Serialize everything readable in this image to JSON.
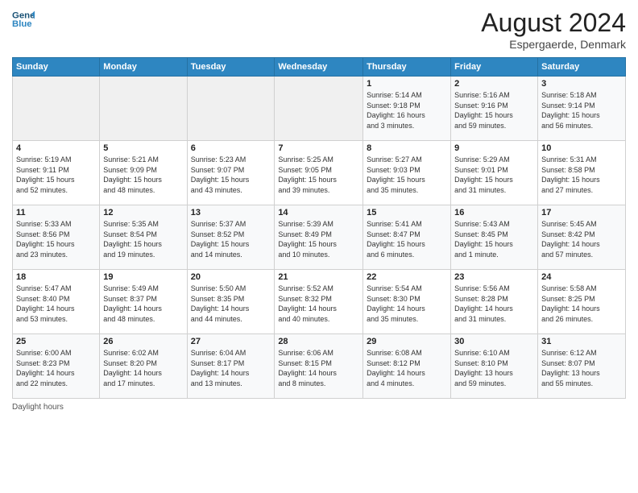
{
  "header": {
    "logo_line1": "General",
    "logo_line2": "Blue",
    "main_title": "August 2024",
    "subtitle": "Espergaerde, Denmark"
  },
  "weekdays": [
    "Sunday",
    "Monday",
    "Tuesday",
    "Wednesday",
    "Thursday",
    "Friday",
    "Saturday"
  ],
  "weeks": [
    [
      {
        "day": "",
        "info": ""
      },
      {
        "day": "",
        "info": ""
      },
      {
        "day": "",
        "info": ""
      },
      {
        "day": "",
        "info": ""
      },
      {
        "day": "1",
        "info": "Sunrise: 5:14 AM\nSunset: 9:18 PM\nDaylight: 16 hours\nand 3 minutes."
      },
      {
        "day": "2",
        "info": "Sunrise: 5:16 AM\nSunset: 9:16 PM\nDaylight: 15 hours\nand 59 minutes."
      },
      {
        "day": "3",
        "info": "Sunrise: 5:18 AM\nSunset: 9:14 PM\nDaylight: 15 hours\nand 56 minutes."
      }
    ],
    [
      {
        "day": "4",
        "info": "Sunrise: 5:19 AM\nSunset: 9:11 PM\nDaylight: 15 hours\nand 52 minutes."
      },
      {
        "day": "5",
        "info": "Sunrise: 5:21 AM\nSunset: 9:09 PM\nDaylight: 15 hours\nand 48 minutes."
      },
      {
        "day": "6",
        "info": "Sunrise: 5:23 AM\nSunset: 9:07 PM\nDaylight: 15 hours\nand 43 minutes."
      },
      {
        "day": "7",
        "info": "Sunrise: 5:25 AM\nSunset: 9:05 PM\nDaylight: 15 hours\nand 39 minutes."
      },
      {
        "day": "8",
        "info": "Sunrise: 5:27 AM\nSunset: 9:03 PM\nDaylight: 15 hours\nand 35 minutes."
      },
      {
        "day": "9",
        "info": "Sunrise: 5:29 AM\nSunset: 9:01 PM\nDaylight: 15 hours\nand 31 minutes."
      },
      {
        "day": "10",
        "info": "Sunrise: 5:31 AM\nSunset: 8:58 PM\nDaylight: 15 hours\nand 27 minutes."
      }
    ],
    [
      {
        "day": "11",
        "info": "Sunrise: 5:33 AM\nSunset: 8:56 PM\nDaylight: 15 hours\nand 23 minutes."
      },
      {
        "day": "12",
        "info": "Sunrise: 5:35 AM\nSunset: 8:54 PM\nDaylight: 15 hours\nand 19 minutes."
      },
      {
        "day": "13",
        "info": "Sunrise: 5:37 AM\nSunset: 8:52 PM\nDaylight: 15 hours\nand 14 minutes."
      },
      {
        "day": "14",
        "info": "Sunrise: 5:39 AM\nSunset: 8:49 PM\nDaylight: 15 hours\nand 10 minutes."
      },
      {
        "day": "15",
        "info": "Sunrise: 5:41 AM\nSunset: 8:47 PM\nDaylight: 15 hours\nand 6 minutes."
      },
      {
        "day": "16",
        "info": "Sunrise: 5:43 AM\nSunset: 8:45 PM\nDaylight: 15 hours\nand 1 minute."
      },
      {
        "day": "17",
        "info": "Sunrise: 5:45 AM\nSunset: 8:42 PM\nDaylight: 14 hours\nand 57 minutes."
      }
    ],
    [
      {
        "day": "18",
        "info": "Sunrise: 5:47 AM\nSunset: 8:40 PM\nDaylight: 14 hours\nand 53 minutes."
      },
      {
        "day": "19",
        "info": "Sunrise: 5:49 AM\nSunset: 8:37 PM\nDaylight: 14 hours\nand 48 minutes."
      },
      {
        "day": "20",
        "info": "Sunrise: 5:50 AM\nSunset: 8:35 PM\nDaylight: 14 hours\nand 44 minutes."
      },
      {
        "day": "21",
        "info": "Sunrise: 5:52 AM\nSunset: 8:32 PM\nDaylight: 14 hours\nand 40 minutes."
      },
      {
        "day": "22",
        "info": "Sunrise: 5:54 AM\nSunset: 8:30 PM\nDaylight: 14 hours\nand 35 minutes."
      },
      {
        "day": "23",
        "info": "Sunrise: 5:56 AM\nSunset: 8:28 PM\nDaylight: 14 hours\nand 31 minutes."
      },
      {
        "day": "24",
        "info": "Sunrise: 5:58 AM\nSunset: 8:25 PM\nDaylight: 14 hours\nand 26 minutes."
      }
    ],
    [
      {
        "day": "25",
        "info": "Sunrise: 6:00 AM\nSunset: 8:23 PM\nDaylight: 14 hours\nand 22 minutes."
      },
      {
        "day": "26",
        "info": "Sunrise: 6:02 AM\nSunset: 8:20 PM\nDaylight: 14 hours\nand 17 minutes."
      },
      {
        "day": "27",
        "info": "Sunrise: 6:04 AM\nSunset: 8:17 PM\nDaylight: 14 hours\nand 13 minutes."
      },
      {
        "day": "28",
        "info": "Sunrise: 6:06 AM\nSunset: 8:15 PM\nDaylight: 14 hours\nand 8 minutes."
      },
      {
        "day": "29",
        "info": "Sunrise: 6:08 AM\nSunset: 8:12 PM\nDaylight: 14 hours\nand 4 minutes."
      },
      {
        "day": "30",
        "info": "Sunrise: 6:10 AM\nSunset: 8:10 PM\nDaylight: 13 hours\nand 59 minutes."
      },
      {
        "day": "31",
        "info": "Sunrise: 6:12 AM\nSunset: 8:07 PM\nDaylight: 13 hours\nand 55 minutes."
      }
    ]
  ],
  "footer": "Daylight hours"
}
